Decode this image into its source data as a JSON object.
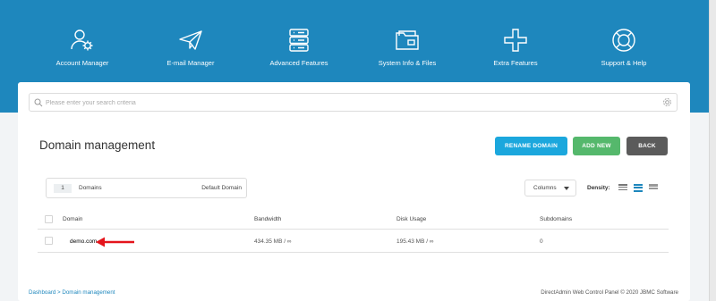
{
  "nav": {
    "items": [
      {
        "label": "Account Manager",
        "icon": "user-gear-icon"
      },
      {
        "label": "E-mail Manager",
        "icon": "paper-plane-icon"
      },
      {
        "label": "Advanced Features",
        "icon": "server-stack-icon"
      },
      {
        "label": "System Info & Files",
        "icon": "folder-icon"
      },
      {
        "label": "Extra Features",
        "icon": "plus-icon"
      },
      {
        "label": "Support & Help",
        "icon": "lifebuoy-icon"
      }
    ]
  },
  "search": {
    "placeholder": "Please enter your search criteria",
    "value": ""
  },
  "page": {
    "title": "Domain management"
  },
  "buttons": {
    "rename": "RENAME DOMAIN",
    "add": "ADD NEW",
    "back": "BACK"
  },
  "info": {
    "count": "1",
    "label": "Domains",
    "default_label": "Default Domain"
  },
  "controls": {
    "columns_label": "Columns",
    "density_label": "Density:",
    "density_selected": "medium"
  },
  "table": {
    "headers": [
      "Domain",
      "Bandwidth",
      "Disk Usage",
      "Subdomains"
    ],
    "rows": [
      {
        "domain": "demo.com",
        "bandwidth": "434.35 MB / ∞",
        "disk_usage": "195.43 MB / ∞",
        "subdomains": "0"
      }
    ]
  },
  "breadcrumb": {
    "items": [
      "Dashboard",
      "Domain management"
    ],
    "separator": ">"
  },
  "footer": {
    "text": "DirectAdmin Web Control Panel © 2020 JBMC Software"
  },
  "colors": {
    "header": "#1e87bd",
    "rename": "#1ba7dd",
    "add": "#55b86c",
    "back": "#5b5b5b",
    "annotation_arrow": "#e4141b"
  }
}
